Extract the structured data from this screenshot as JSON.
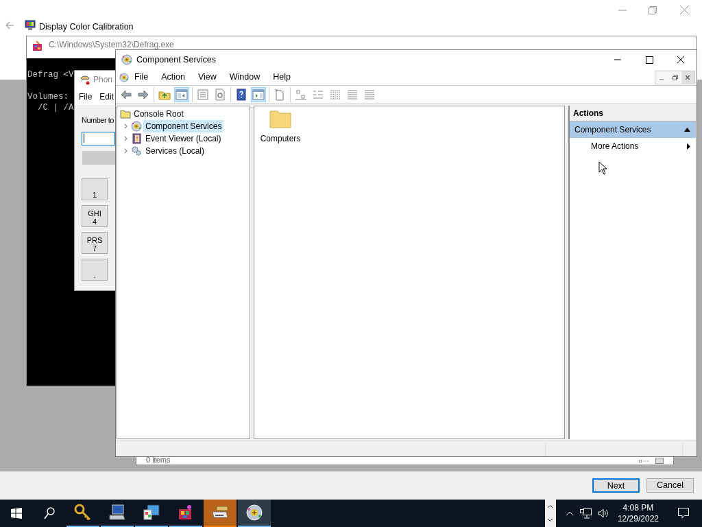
{
  "calibration_window": {
    "title": "Display Color Calibration",
    "buttons": [
      {
        "label": "Next",
        "focused": true
      },
      {
        "label": "Cancel",
        "focused": false
      }
    ]
  },
  "defrag_window": {
    "title": "C:\\Windows\\System32\\Defrag.exe",
    "console_paragraphs": [
      [
        "Defrag <V"
      ],
      [
        "Volumes:",
        "  /C | /A"
      ]
    ]
  },
  "phone_window": {
    "title": "Phon",
    "menu": [
      "File",
      "Edit"
    ],
    "field_label": "Number to",
    "keys": [
      {
        "digit": "1"
      },
      {
        "letters": "GHI",
        "digit": "4"
      },
      {
        "letters": "PRS",
        "digit": "7"
      },
      {
        "digit": "."
      }
    ]
  },
  "back_window": {
    "status": "0 items"
  },
  "component_services": {
    "title": "Component Services",
    "menu": [
      "File",
      "Action",
      "View",
      "Window",
      "Help"
    ],
    "toolbar": [
      [
        {
          "pressed": false
        },
        {
          "pressed": false
        }
      ],
      [
        {
          "pressed": false
        },
        {
          "pressed": true
        }
      ],
      [
        {
          "pressed": false
        },
        {
          "pressed": false
        }
      ],
      [
        {
          "pressed": false
        },
        {
          "pressed": true
        }
      ],
      [
        {
          "pressed": false
        }
      ],
      [
        {
          "pressed": false
        },
        {
          "pressed": false
        },
        {
          "pressed": false
        },
        {
          "pressed": false
        },
        {
          "pressed": false
        }
      ]
    ],
    "tree": {
      "label": "Console Root",
      "selected": false,
      "children": [
        {
          "label": "Component Services",
          "selected": true,
          "expanded": false
        },
        {
          "label": "Event Viewer (Local)",
          "selected": false,
          "expanded": false
        },
        {
          "label": "Services (Local)",
          "selected": false,
          "expanded": false
        }
      ]
    },
    "items": [
      {
        "label": "Computers"
      }
    ],
    "actions": {
      "header": "Actions",
      "group": {
        "label": "Component Services",
        "expanded": true
      },
      "items": [
        {
          "label": "More Actions",
          "submenu": true
        }
      ]
    }
  },
  "taskbar": {
    "apps": [
      {
        "attention": false,
        "focused": false
      },
      {
        "attention": false,
        "focused": false
      },
      {
        "attention": false,
        "focused": false
      },
      {
        "attention": false,
        "focused": false
      },
      {
        "attention": true,
        "focused": false
      },
      {
        "attention": false,
        "focused": true
      }
    ],
    "time": "4:08 PM",
    "date": "12/29/2022"
  }
}
